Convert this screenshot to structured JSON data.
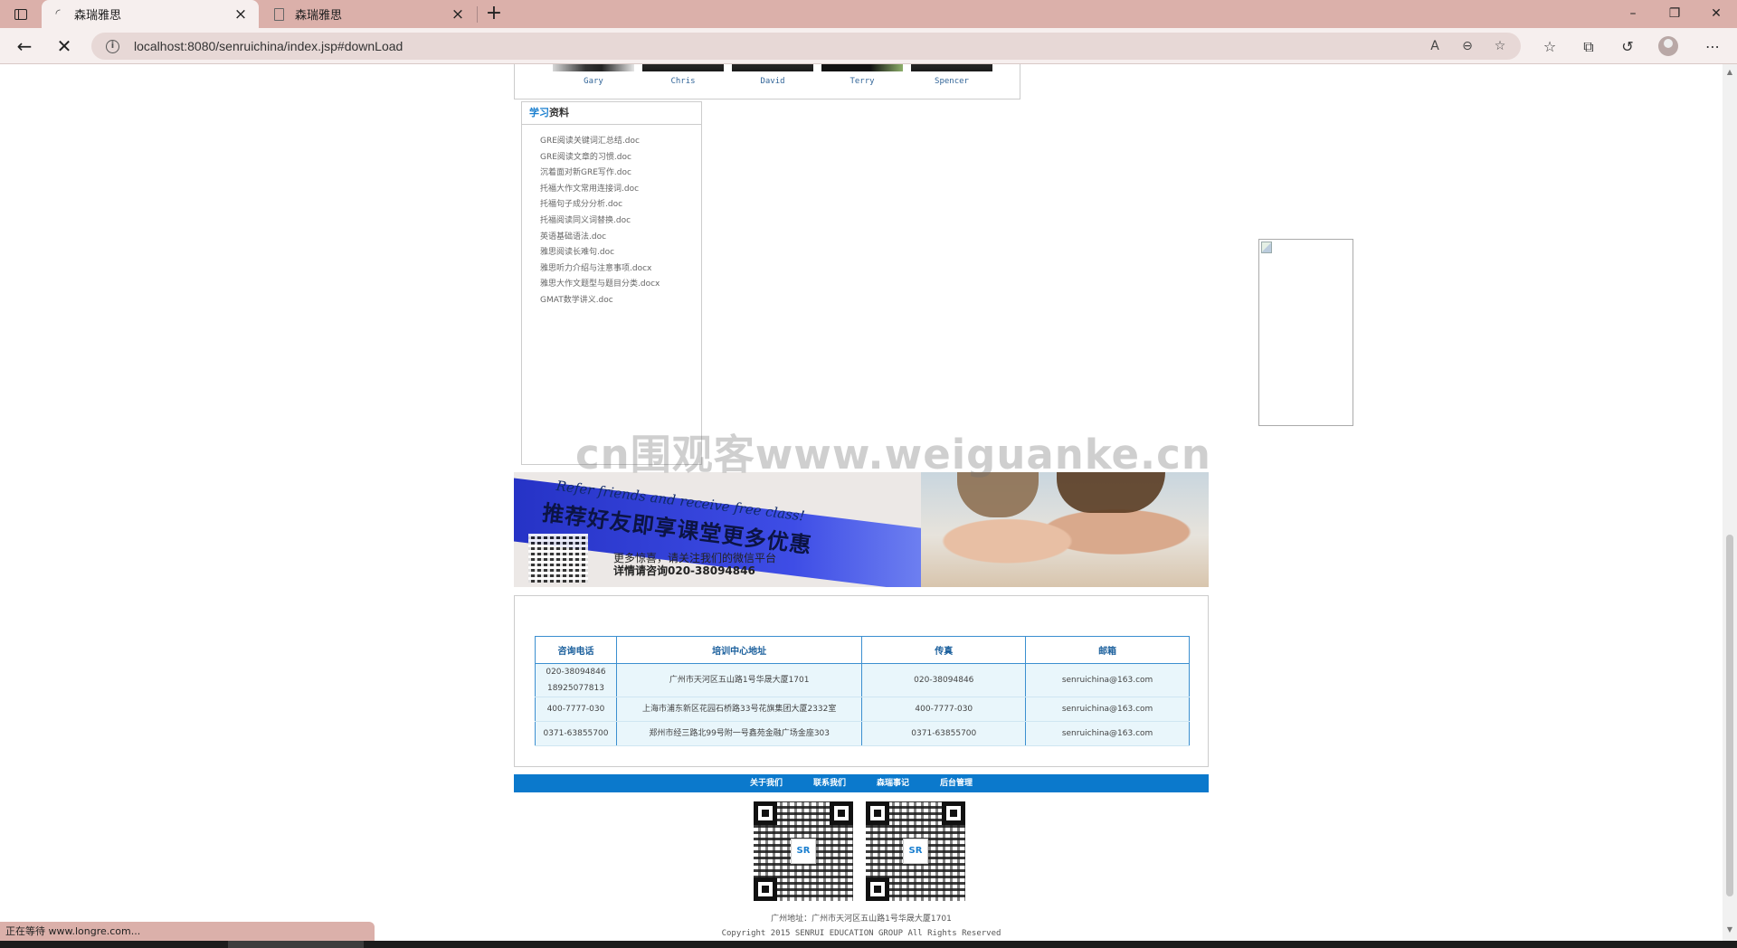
{
  "browser": {
    "tabs": [
      {
        "title": "森瑞雅思",
        "active": true,
        "loading": true
      },
      {
        "title": "森瑞雅思",
        "active": false,
        "loading": false
      }
    ],
    "url": "localhost:8080/senruichina/index.jsp#downLoad",
    "status_text": "正在等待 www.longre.com...",
    "window_controls": {
      "minimize": "–",
      "restore": "❐",
      "close": "✕"
    }
  },
  "teachers": [
    "Gary",
    "Chris",
    "David",
    "Terry",
    "Spencer"
  ],
  "study": {
    "title_highlight": "学习",
    "title_rest": "资料",
    "files": [
      "GRE阅读关键词汇总结.doc",
      "GRE阅读文章的习惯.doc",
      "沉着面对新GRE写作.doc",
      "托福大作文常用连接词.doc",
      "托福句子成分分析.doc",
      "托福阅读同义词替换.doc",
      "英语基础语法.doc",
      "雅思阅读长难句.doc",
      "雅思听力介绍与注意事项.docx",
      "雅思大作文题型与题目分类.docx",
      "GMAT数学讲义.doc"
    ]
  },
  "watermark": "cn围观客www.weiguanke.cn",
  "banner": {
    "english": "Refer friends and receive free class!",
    "chinese": "推荐好友即享课堂更多优惠",
    "line1": "更多惊喜，请关注我们的微信平台",
    "line2": "详情请咨询020-38094846"
  },
  "contact": {
    "headers": [
      "咨询电话",
      "培训中心地址",
      "传真",
      "邮箱"
    ],
    "rows": [
      [
        "020-38094846\n18925077813",
        "广州市天河区五山路1号华晟大厦1701",
        "020-38094846",
        "senruichina@163.com"
      ],
      [
        "400-7777-030",
        "上海市浦东新区花园石桥路33号花旗集团大厦2332室",
        "400-7777-030",
        "senruichina@163.com"
      ],
      [
        "0371-63855700",
        "郑州市经三路北99号附一号鑫苑金融广场金座303",
        "0371-63855700",
        "senruichina@163.com"
      ]
    ]
  },
  "footer": {
    "nav": [
      "关于我们",
      "联系我们",
      "森瑞事记",
      "后台管理"
    ],
    "qr_logo": "SR",
    "address": "广州地址：广州市天河区五山路1号华晟大厦1701",
    "copyright": "Copyright 2015 SENRUI EDUCATION GROUP All Rights Reserved"
  }
}
